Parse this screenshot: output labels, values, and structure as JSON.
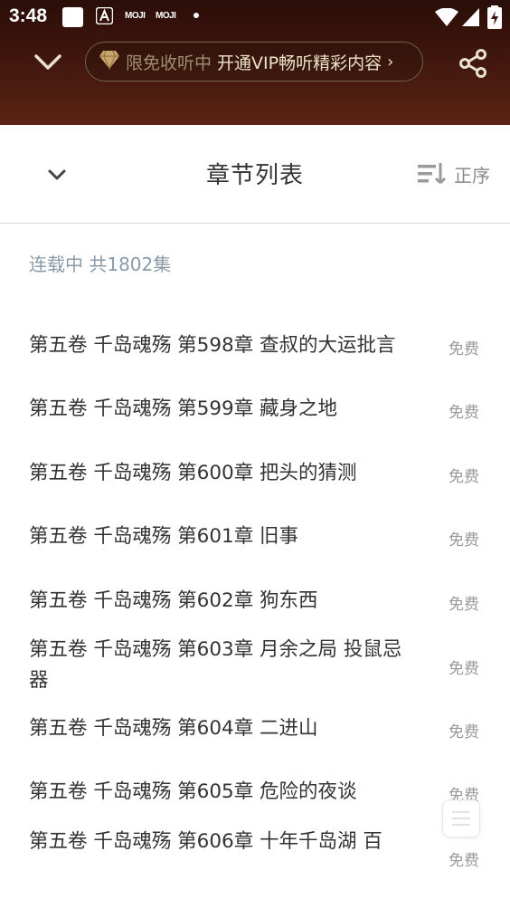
{
  "status_bar": {
    "time": "3:48",
    "moji_1": "MOJI",
    "moji_2": "MOJI",
    "icons": [
      "notification-square-icon",
      "app-a-icon",
      "wifi-icon",
      "signal-icon",
      "battery-charging-icon"
    ]
  },
  "top_bar": {
    "promo_text": "限免收听中",
    "vip_cta": "开通VIP畅听精彩内容",
    "arrow": "›",
    "icons": [
      "chevron-down-icon",
      "diamond-icon",
      "share-icon"
    ]
  },
  "chapter_sheet": {
    "title": "章节列表",
    "sort_label": "正序",
    "serial_info": "连载中 共1802集",
    "chapters": [
      {
        "title": "第五卷  千岛魂殇 第598章 查叔的大运批言",
        "price": "免费"
      },
      {
        "title": "第五卷  千岛魂殇 第599章 藏身之地",
        "price": "免费"
      },
      {
        "title": "第五卷  千岛魂殇 第600章 把头的猜测",
        "price": "免费"
      },
      {
        "title": "第五卷  千岛魂殇 第601章 旧事",
        "price": "免费"
      },
      {
        "title": "第五卷  千岛魂殇 第602章 狗东西",
        "price": "免费"
      },
      {
        "title": "第五卷  千岛魂殇 第603章 月余之局 投鼠忌器",
        "price": "免费"
      },
      {
        "title": "第五卷  千岛魂殇 第604章 二进山",
        "price": "免费"
      },
      {
        "title": "第五卷  千岛魂殇 第605章 危险的夜谈",
        "price": "免费"
      },
      {
        "title": "第五卷  千岛魂殇 第606章 十年千岛湖 百",
        "price": "免费"
      }
    ]
  },
  "colors": {
    "header_bg": "#3d150c",
    "vip_border": "#6f6343",
    "vip_text": "#ece2c8",
    "promo_text": "#9c8f6e",
    "title_text": "#333333",
    "muted_text": "#999999",
    "serial_text": "#8a9aa8"
  }
}
